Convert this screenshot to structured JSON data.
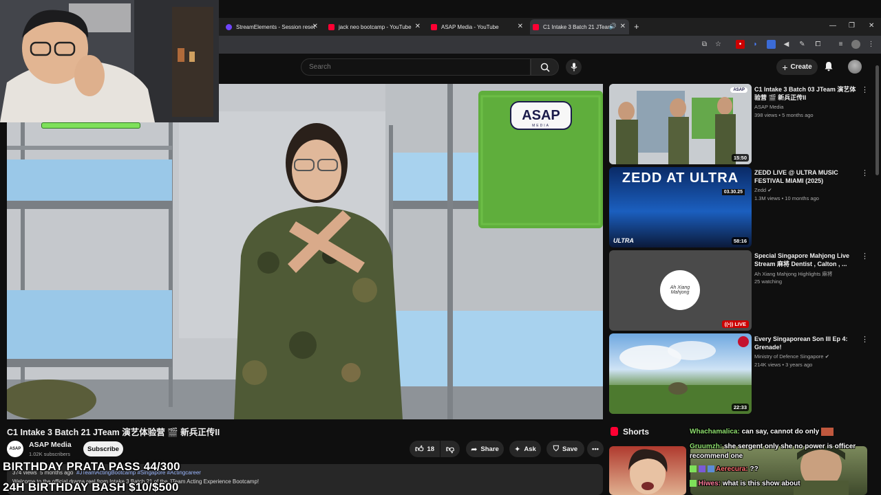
{
  "tabs": [
    {
      "title": "StreamElements - Session reset",
      "color": "#6f45ff"
    },
    {
      "title": "jack neo bootcamp - YouTube",
      "color": "#ff0033"
    },
    {
      "title": "ASAP Media - YouTube",
      "color": "#ff0033"
    },
    {
      "title": "C1 Intake 3 Batch 21 JTeam",
      "color": "#ff0033"
    }
  ],
  "header": {
    "search_placeholder": "Search",
    "create_label": "Create"
  },
  "player": {
    "logo_text": "ASAP",
    "logo_sub": "MEDIA"
  },
  "video": {
    "title": "C1 Intake 3 Batch 21 JTeam 演艺体验营 🎬 新兵正传II",
    "channel": {
      "name": "ASAP Media",
      "subscribers": "1.02K subscribers",
      "avatar_text": "ASAP"
    },
    "subscribe_label": "Subscribe",
    "actions": {
      "likes": "18",
      "share": "Share",
      "ask": "Ask",
      "save": "Save"
    },
    "description": {
      "views": "374 views",
      "age": "5 months ago",
      "tags": "#JTeamActingBootcamp #Singapore #Actingcareer",
      "text": "Welcome to the official drama reel from Intake 3 Batch 21 of the JTeam Acting Experience Bootcamp!"
    }
  },
  "overlay": {
    "line1": "BIRTHDAY PRATA PASS 44/300",
    "line2": "24H BIRTHDAY BASH $10/$500"
  },
  "recommendations": [
    {
      "title": "C1 Intake 3 Batch 03 JTeam 演艺体验营 🎬 新兵正传II",
      "channel": "ASAP Media",
      "meta": "398 views • 5 months ago",
      "duration": "15:50",
      "badge": "ASAP"
    },
    {
      "title": "ZEDD LIVE @ ULTRA MUSIC FESTIVAL MIAMI (2025)",
      "channel": "Zedd",
      "meta": "1.3M views • 10 months ago",
      "duration": "58:16",
      "banner": "ZEDD AT ULTRA",
      "date": "03.30.25",
      "brand": "ULTRA"
    },
    {
      "title": "Special Singapore Mahjong Live Stream 麻将 Dentist , Calton , ...",
      "channel": "Ah Xiang Mahjong Highlights 麻将",
      "meta": "25 watching",
      "live": "LIVE",
      "logo_line1": "Ah Xiang",
      "logo_line2": "Mahjong"
    },
    {
      "title": "Every Singaporean Son III Ep 4: Grenade!",
      "channel": "Ministry of Defence Singapore",
      "meta": "214K views • 3 years ago",
      "duration": "22:33"
    }
  ],
  "shorts_label": "Shorts",
  "chat": [
    {
      "user": "Whachamalica:",
      "msg": "can say, cannot do only"
    },
    {
      "user": "Gruumzh:",
      "msg": "she sergent only she no power is officer"
    },
    {
      "user": "",
      "msg": "recommend one"
    },
    {
      "user": "Aerecura:",
      "msg": "??"
    },
    {
      "user": "Hiwes:",
      "msg": "what is this show about"
    }
  ],
  "colors": {
    "accent_red": "#ff0033",
    "background": "#0f0f0f",
    "chip": "#272727"
  }
}
